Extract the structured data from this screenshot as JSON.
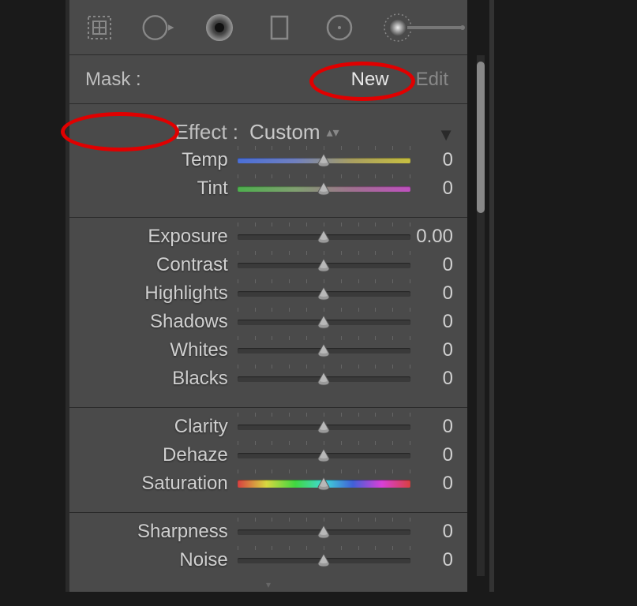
{
  "mask": {
    "label": "Mask :",
    "new": "New",
    "edit": "Edit"
  },
  "effect": {
    "label": "Effect :",
    "value": "Custom"
  },
  "toolIcons": [
    "crop-grid-icon",
    "radial-circle-icon",
    "radial-filled-icon",
    "rect-select-icon",
    "circle-point-icon",
    "brush-range-icon"
  ],
  "groups": [
    {
      "specialTop": true,
      "rows": [
        {
          "label": "Temp",
          "value": "0",
          "gradient": "temp"
        },
        {
          "label": "Tint",
          "value": "0",
          "gradient": "tint"
        }
      ]
    },
    {
      "rows": [
        {
          "label": "Exposure",
          "value": "0.00"
        },
        {
          "label": "Contrast",
          "value": "0"
        },
        {
          "label": "Highlights",
          "value": "0"
        },
        {
          "label": "Shadows",
          "value": "0"
        },
        {
          "label": "Whites",
          "value": "0"
        },
        {
          "label": "Blacks",
          "value": "0"
        }
      ]
    },
    {
      "rows": [
        {
          "label": "Clarity",
          "value": "0"
        },
        {
          "label": "Dehaze",
          "value": "0"
        },
        {
          "label": "Saturation",
          "value": "0",
          "gradient": "sat"
        }
      ]
    },
    {
      "rows": [
        {
          "label": "Sharpness",
          "value": "0"
        },
        {
          "label": "Noise",
          "value": "0"
        }
      ]
    }
  ]
}
